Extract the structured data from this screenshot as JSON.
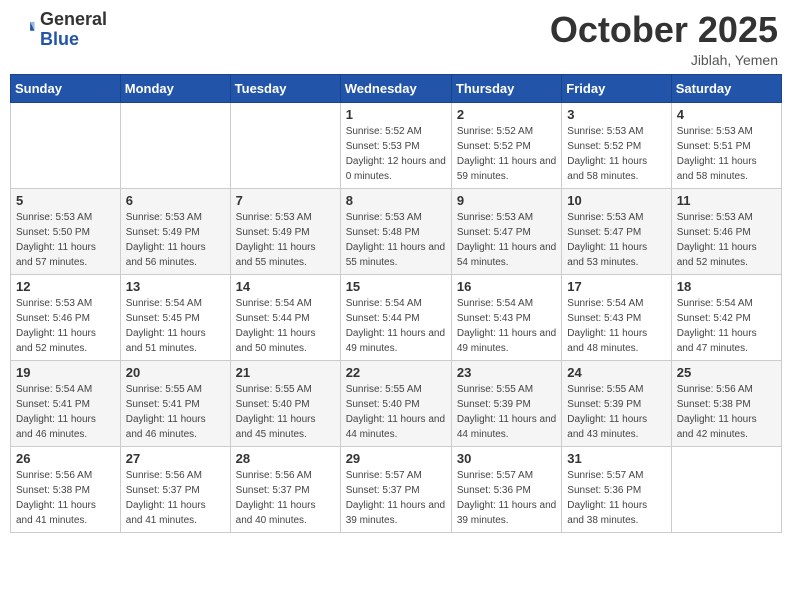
{
  "header": {
    "logo_general": "General",
    "logo_blue": "Blue",
    "month": "October 2025",
    "location": "Jiblah, Yemen"
  },
  "weekdays": [
    "Sunday",
    "Monday",
    "Tuesday",
    "Wednesday",
    "Thursday",
    "Friday",
    "Saturday"
  ],
  "weeks": [
    [
      {
        "day": "",
        "sunrise": "",
        "sunset": "",
        "daylight": ""
      },
      {
        "day": "",
        "sunrise": "",
        "sunset": "",
        "daylight": ""
      },
      {
        "day": "",
        "sunrise": "",
        "sunset": "",
        "daylight": ""
      },
      {
        "day": "1",
        "sunrise": "Sunrise: 5:52 AM",
        "sunset": "Sunset: 5:53 PM",
        "daylight": "Daylight: 12 hours and 0 minutes."
      },
      {
        "day": "2",
        "sunrise": "Sunrise: 5:52 AM",
        "sunset": "Sunset: 5:52 PM",
        "daylight": "Daylight: 11 hours and 59 minutes."
      },
      {
        "day": "3",
        "sunrise": "Sunrise: 5:53 AM",
        "sunset": "Sunset: 5:52 PM",
        "daylight": "Daylight: 11 hours and 58 minutes."
      },
      {
        "day": "4",
        "sunrise": "Sunrise: 5:53 AM",
        "sunset": "Sunset: 5:51 PM",
        "daylight": "Daylight: 11 hours and 58 minutes."
      }
    ],
    [
      {
        "day": "5",
        "sunrise": "Sunrise: 5:53 AM",
        "sunset": "Sunset: 5:50 PM",
        "daylight": "Daylight: 11 hours and 57 minutes."
      },
      {
        "day": "6",
        "sunrise": "Sunrise: 5:53 AM",
        "sunset": "Sunset: 5:49 PM",
        "daylight": "Daylight: 11 hours and 56 minutes."
      },
      {
        "day": "7",
        "sunrise": "Sunrise: 5:53 AM",
        "sunset": "Sunset: 5:49 PM",
        "daylight": "Daylight: 11 hours and 55 minutes."
      },
      {
        "day": "8",
        "sunrise": "Sunrise: 5:53 AM",
        "sunset": "Sunset: 5:48 PM",
        "daylight": "Daylight: 11 hours and 55 minutes."
      },
      {
        "day": "9",
        "sunrise": "Sunrise: 5:53 AM",
        "sunset": "Sunset: 5:47 PM",
        "daylight": "Daylight: 11 hours and 54 minutes."
      },
      {
        "day": "10",
        "sunrise": "Sunrise: 5:53 AM",
        "sunset": "Sunset: 5:47 PM",
        "daylight": "Daylight: 11 hours and 53 minutes."
      },
      {
        "day": "11",
        "sunrise": "Sunrise: 5:53 AM",
        "sunset": "Sunset: 5:46 PM",
        "daylight": "Daylight: 11 hours and 52 minutes."
      }
    ],
    [
      {
        "day": "12",
        "sunrise": "Sunrise: 5:53 AM",
        "sunset": "Sunset: 5:46 PM",
        "daylight": "Daylight: 11 hours and 52 minutes."
      },
      {
        "day": "13",
        "sunrise": "Sunrise: 5:54 AM",
        "sunset": "Sunset: 5:45 PM",
        "daylight": "Daylight: 11 hours and 51 minutes."
      },
      {
        "day": "14",
        "sunrise": "Sunrise: 5:54 AM",
        "sunset": "Sunset: 5:44 PM",
        "daylight": "Daylight: 11 hours and 50 minutes."
      },
      {
        "day": "15",
        "sunrise": "Sunrise: 5:54 AM",
        "sunset": "Sunset: 5:44 PM",
        "daylight": "Daylight: 11 hours and 49 minutes."
      },
      {
        "day": "16",
        "sunrise": "Sunrise: 5:54 AM",
        "sunset": "Sunset: 5:43 PM",
        "daylight": "Daylight: 11 hours and 49 minutes."
      },
      {
        "day": "17",
        "sunrise": "Sunrise: 5:54 AM",
        "sunset": "Sunset: 5:43 PM",
        "daylight": "Daylight: 11 hours and 48 minutes."
      },
      {
        "day": "18",
        "sunrise": "Sunrise: 5:54 AM",
        "sunset": "Sunset: 5:42 PM",
        "daylight": "Daylight: 11 hours and 47 minutes."
      }
    ],
    [
      {
        "day": "19",
        "sunrise": "Sunrise: 5:54 AM",
        "sunset": "Sunset: 5:41 PM",
        "daylight": "Daylight: 11 hours and 46 minutes."
      },
      {
        "day": "20",
        "sunrise": "Sunrise: 5:55 AM",
        "sunset": "Sunset: 5:41 PM",
        "daylight": "Daylight: 11 hours and 46 minutes."
      },
      {
        "day": "21",
        "sunrise": "Sunrise: 5:55 AM",
        "sunset": "Sunset: 5:40 PM",
        "daylight": "Daylight: 11 hours and 45 minutes."
      },
      {
        "day": "22",
        "sunrise": "Sunrise: 5:55 AM",
        "sunset": "Sunset: 5:40 PM",
        "daylight": "Daylight: 11 hours and 44 minutes."
      },
      {
        "day": "23",
        "sunrise": "Sunrise: 5:55 AM",
        "sunset": "Sunset: 5:39 PM",
        "daylight": "Daylight: 11 hours and 44 minutes."
      },
      {
        "day": "24",
        "sunrise": "Sunrise: 5:55 AM",
        "sunset": "Sunset: 5:39 PM",
        "daylight": "Daylight: 11 hours and 43 minutes."
      },
      {
        "day": "25",
        "sunrise": "Sunrise: 5:56 AM",
        "sunset": "Sunset: 5:38 PM",
        "daylight": "Daylight: 11 hours and 42 minutes."
      }
    ],
    [
      {
        "day": "26",
        "sunrise": "Sunrise: 5:56 AM",
        "sunset": "Sunset: 5:38 PM",
        "daylight": "Daylight: 11 hours and 41 minutes."
      },
      {
        "day": "27",
        "sunrise": "Sunrise: 5:56 AM",
        "sunset": "Sunset: 5:37 PM",
        "daylight": "Daylight: 11 hours and 41 minutes."
      },
      {
        "day": "28",
        "sunrise": "Sunrise: 5:56 AM",
        "sunset": "Sunset: 5:37 PM",
        "daylight": "Daylight: 11 hours and 40 minutes."
      },
      {
        "day": "29",
        "sunrise": "Sunrise: 5:57 AM",
        "sunset": "Sunset: 5:37 PM",
        "daylight": "Daylight: 11 hours and 39 minutes."
      },
      {
        "day": "30",
        "sunrise": "Sunrise: 5:57 AM",
        "sunset": "Sunset: 5:36 PM",
        "daylight": "Daylight: 11 hours and 39 minutes."
      },
      {
        "day": "31",
        "sunrise": "Sunrise: 5:57 AM",
        "sunset": "Sunset: 5:36 PM",
        "daylight": "Daylight: 11 hours and 38 minutes."
      },
      {
        "day": "",
        "sunrise": "",
        "sunset": "",
        "daylight": ""
      }
    ]
  ]
}
